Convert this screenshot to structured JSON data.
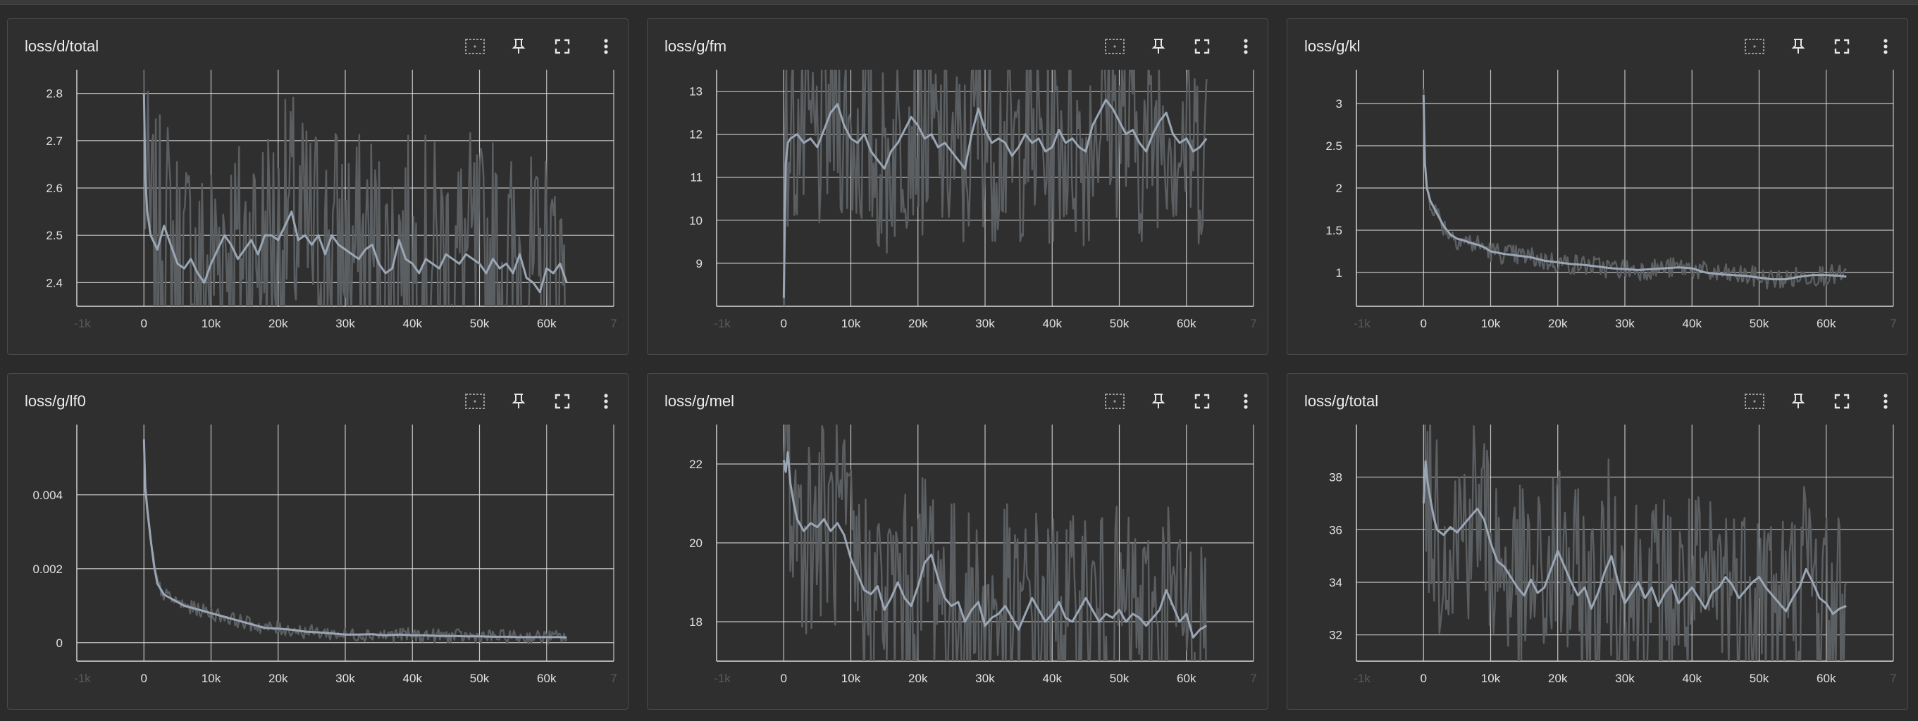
{
  "colors": {
    "raw": "#5c5f62",
    "smoothed": "#9aa6b4",
    "grid": "#dcdcdc",
    "background": "#2f2f2f"
  },
  "toolbar_icons": [
    "fit-domain-icon",
    "pin-icon",
    "fullscreen-icon",
    "more-vert-icon"
  ],
  "chart_data": [
    {
      "id": "loss_d_total",
      "title": "loss/d/total",
      "type": "line",
      "xlim": [
        -10000,
        70000
      ],
      "ylim": [
        2.35,
        2.85
      ],
      "xticks": [
        0,
        10000,
        20000,
        30000,
        40000,
        50000,
        60000
      ],
      "xtick_labels": [
        "0",
        "10k",
        "20k",
        "30k",
        "40k",
        "50k",
        "60k"
      ],
      "xedge_labels": [
        "-1k",
        "7"
      ],
      "yticks": [
        2.4,
        2.5,
        2.6,
        2.7,
        2.8
      ],
      "ytick_labels": [
        "2.4",
        "2.5",
        "2.6",
        "2.7",
        "2.8"
      ],
      "x": [
        0,
        200,
        500,
        1000,
        2000,
        3000,
        4000,
        5000,
        6000,
        7000,
        8000,
        9000,
        10000,
        11000,
        12000,
        13000,
        14000,
        15000,
        16000,
        17000,
        18000,
        19000,
        20000,
        21000,
        22000,
        23000,
        24000,
        25000,
        26000,
        27000,
        28000,
        29000,
        30000,
        31000,
        32000,
        33000,
        34000,
        35000,
        36000,
        37000,
        38000,
        39000,
        40000,
        41000,
        42000,
        43000,
        44000,
        45000,
        46000,
        47000,
        48000,
        49000,
        50000,
        51000,
        52000,
        53000,
        54000,
        55000,
        56000,
        57000,
        58000,
        59000,
        60000,
        61000,
        62000,
        63000
      ],
      "smoothed": [
        2.8,
        2.62,
        2.55,
        2.5,
        2.47,
        2.52,
        2.48,
        2.44,
        2.43,
        2.45,
        2.42,
        2.4,
        2.44,
        2.47,
        2.5,
        2.48,
        2.45,
        2.47,
        2.49,
        2.46,
        2.5,
        2.5,
        2.49,
        2.52,
        2.55,
        2.49,
        2.5,
        2.48,
        2.5,
        2.46,
        2.5,
        2.48,
        2.47,
        2.46,
        2.45,
        2.47,
        2.48,
        2.44,
        2.42,
        2.43,
        2.49,
        2.45,
        2.44,
        2.42,
        2.45,
        2.44,
        2.43,
        2.46,
        2.45,
        2.44,
        2.46,
        2.45,
        2.44,
        2.42,
        2.45,
        2.43,
        2.44,
        2.42,
        2.46,
        2.41,
        2.4,
        2.38,
        2.43,
        2.42,
        2.44,
        2.4
      ],
      "raw_range": [
        2.3,
        2.9
      ]
    },
    {
      "id": "loss_g_fm",
      "title": "loss/g/fm",
      "type": "line",
      "xlim": [
        -10000,
        70000
      ],
      "ylim": [
        8.0,
        13.5
      ],
      "xticks": [
        0,
        10000,
        20000,
        30000,
        40000,
        50000,
        60000
      ],
      "xtick_labels": [
        "0",
        "10k",
        "20k",
        "30k",
        "40k",
        "50k",
        "60k"
      ],
      "xedge_labels": [
        "-1k",
        "7"
      ],
      "yticks": [
        9,
        10,
        11,
        12,
        13
      ],
      "ytick_labels": [
        "9",
        "10",
        "11",
        "12",
        "13"
      ],
      "x": [
        0,
        300,
        600,
        1000,
        2000,
        3000,
        4000,
        5000,
        6000,
        7000,
        8000,
        9000,
        10000,
        11000,
        12000,
        13000,
        14000,
        15000,
        16000,
        17000,
        18000,
        19000,
        20000,
        21000,
        22000,
        23000,
        24000,
        25000,
        26000,
        27000,
        28000,
        29000,
        30000,
        31000,
        32000,
        33000,
        34000,
        35000,
        36000,
        37000,
        38000,
        39000,
        40000,
        41000,
        42000,
        43000,
        44000,
        45000,
        46000,
        47000,
        48000,
        49000,
        50000,
        51000,
        52000,
        53000,
        54000,
        55000,
        56000,
        57000,
        58000,
        59000,
        60000,
        61000,
        62000,
        63000
      ],
      "smoothed": [
        8.2,
        11.3,
        11.8,
        11.9,
        12.0,
        11.8,
        11.9,
        11.7,
        12.1,
        12.5,
        12.7,
        12.2,
        11.9,
        11.8,
        12.0,
        11.6,
        11.4,
        11.2,
        11.6,
        11.8,
        12.1,
        12.4,
        12.2,
        11.9,
        12.0,
        11.7,
        11.8,
        11.6,
        11.4,
        11.2,
        12.0,
        12.6,
        12.1,
        11.8,
        11.9,
        11.8,
        11.5,
        11.7,
        12.0,
        11.8,
        11.9,
        11.6,
        11.7,
        12.1,
        11.8,
        11.9,
        11.7,
        11.6,
        12.2,
        12.5,
        12.8,
        12.6,
        12.3,
        12.0,
        12.1,
        11.8,
        11.6,
        12.0,
        12.3,
        12.5,
        12.0,
        11.8,
        11.9,
        11.6,
        11.7,
        11.9
      ],
      "raw_range": [
        8.5,
        13.8
      ]
    },
    {
      "id": "loss_g_kl",
      "title": "loss/g/kl",
      "type": "line",
      "xlim": [
        -10000,
        70000
      ],
      "ylim": [
        0.6,
        3.4
      ],
      "xticks": [
        0,
        10000,
        20000,
        30000,
        40000,
        50000,
        60000
      ],
      "xtick_labels": [
        "0",
        "10k",
        "20k",
        "30k",
        "40k",
        "50k",
        "60k"
      ],
      "xedge_labels": [
        "-1k",
        "7"
      ],
      "yticks": [
        1,
        1.5,
        2,
        2.5,
        3
      ],
      "ytick_labels": [
        "1",
        "1.5",
        "2",
        "2.5",
        "3"
      ],
      "x": [
        0,
        200,
        500,
        1000,
        2000,
        3000,
        4000,
        5000,
        6000,
        7000,
        8000,
        9000,
        10000,
        12000,
        14000,
        16000,
        18000,
        20000,
        22000,
        24000,
        26000,
        28000,
        30000,
        32000,
        34000,
        36000,
        38000,
        40000,
        42000,
        44000,
        46000,
        48000,
        50000,
        52000,
        54000,
        56000,
        58000,
        60000,
        62000,
        63000
      ],
      "smoothed": [
        3.1,
        2.3,
        2.0,
        1.85,
        1.7,
        1.55,
        1.45,
        1.4,
        1.38,
        1.35,
        1.33,
        1.3,
        1.25,
        1.22,
        1.2,
        1.18,
        1.14,
        1.12,
        1.1,
        1.09,
        1.07,
        1.05,
        1.04,
        1.03,
        1.04,
        1.05,
        1.06,
        1.05,
        1.0,
        0.98,
        0.97,
        0.96,
        0.94,
        0.92,
        0.92,
        0.95,
        0.97,
        0.97,
        0.96,
        0.95
      ],
      "raw_range": [
        0.8,
        1.6
      ]
    },
    {
      "id": "loss_g_lf0",
      "title": "loss/g/lf0",
      "type": "line",
      "xlim": [
        -10000,
        70000
      ],
      "ylim": [
        -0.0005,
        0.0059
      ],
      "xticks": [
        0,
        10000,
        20000,
        30000,
        40000,
        50000,
        60000
      ],
      "xtick_labels": [
        "0",
        "10k",
        "20k",
        "30k",
        "40k",
        "50k",
        "60k"
      ],
      "xedge_labels": [
        "-1k",
        "7"
      ],
      "yticks": [
        0,
        0.002,
        0.004
      ],
      "ytick_labels": [
        "0",
        "0.002",
        "0.004"
      ],
      "x": [
        0,
        200,
        500,
        1000,
        1500,
        2000,
        3000,
        4000,
        5000,
        6000,
        8000,
        10000,
        12000,
        14000,
        16000,
        18000,
        20000,
        22000,
        24000,
        26000,
        28000,
        30000,
        32000,
        34000,
        36000,
        38000,
        40000,
        42000,
        44000,
        46000,
        48000,
        50000,
        52000,
        54000,
        56000,
        58000,
        60000,
        62000,
        63000
      ],
      "smoothed": [
        0.0055,
        0.0042,
        0.0036,
        0.0028,
        0.0021,
        0.0016,
        0.0013,
        0.0012,
        0.0011,
        0.001,
        0.0009,
        0.0008,
        0.0007,
        0.0006,
        0.0005,
        0.0004,
        0.00038,
        0.00035,
        0.0003,
        0.00028,
        0.00025,
        0.00022,
        0.00022,
        0.00023,
        0.0002,
        0.00022,
        0.0002,
        0.0002,
        0.00018,
        0.00018,
        0.00017,
        0.00017,
        0.00016,
        0.00016,
        0.00015,
        0.00015,
        0.00015,
        0.00015,
        0.00014
      ],
      "raw_range": [
        0.0,
        0.0012
      ]
    },
    {
      "id": "loss_g_mel",
      "title": "loss/g/mel",
      "type": "line",
      "xlim": [
        -10000,
        70000
      ],
      "ylim": [
        17.0,
        23.0
      ],
      "xticks": [
        0,
        10000,
        20000,
        30000,
        40000,
        50000,
        60000
      ],
      "xtick_labels": [
        "0",
        "10k",
        "20k",
        "30k",
        "40k",
        "50k",
        "60k"
      ],
      "xedge_labels": [
        "-1k",
        "7"
      ],
      "yticks": [
        18,
        20,
        22
      ],
      "ytick_labels": [
        "18",
        "20",
        "22"
      ],
      "x": [
        0,
        300,
        600,
        1000,
        1500,
        2000,
        3000,
        4000,
        5000,
        6000,
        7000,
        8000,
        9000,
        10000,
        11000,
        12000,
        13000,
        14000,
        15000,
        16000,
        17000,
        18000,
        19000,
        20000,
        21000,
        22000,
        23000,
        24000,
        25000,
        26000,
        27000,
        28000,
        29000,
        30000,
        31000,
        32000,
        33000,
        34000,
        35000,
        36000,
        37000,
        38000,
        39000,
        40000,
        41000,
        42000,
        43000,
        44000,
        45000,
        46000,
        47000,
        48000,
        49000,
        50000,
        51000,
        52000,
        53000,
        54000,
        55000,
        56000,
        57000,
        58000,
        59000,
        60000,
        61000,
        62000,
        63000
      ],
      "smoothed": [
        22.1,
        21.8,
        22.3,
        21.5,
        21.0,
        20.6,
        20.3,
        20.5,
        20.4,
        20.6,
        20.3,
        20.5,
        20.2,
        19.6,
        19.2,
        18.8,
        18.7,
        18.9,
        18.3,
        18.6,
        19.0,
        18.6,
        18.4,
        18.9,
        19.5,
        19.7,
        19.1,
        18.6,
        18.4,
        18.5,
        18.0,
        18.3,
        18.5,
        17.9,
        18.1,
        18.2,
        18.4,
        18.1,
        17.8,
        18.2,
        18.6,
        18.3,
        18.0,
        18.2,
        18.5,
        18.1,
        18.0,
        18.3,
        18.6,
        18.3,
        18.0,
        18.2,
        18.1,
        18.3,
        18.0,
        18.2,
        18.1,
        17.9,
        18.1,
        18.3,
        18.8,
        18.4,
        18.0,
        18.2,
        17.6,
        17.8,
        17.9
      ],
      "raw_range": [
        17.0,
        23.0
      ]
    },
    {
      "id": "loss_g_total",
      "title": "loss/g/total",
      "type": "line",
      "xlim": [
        -10000,
        70000
      ],
      "ylim": [
        31.0,
        40.0
      ],
      "xticks": [
        0,
        10000,
        20000,
        30000,
        40000,
        50000,
        60000
      ],
      "xtick_labels": [
        "0",
        "10k",
        "20k",
        "30k",
        "40k",
        "50k",
        "60k"
      ],
      "xedge_labels": [
        "-1k",
        "7"
      ],
      "yticks": [
        32,
        34,
        36,
        38
      ],
      "ytick_labels": [
        "32",
        "34",
        "36",
        "38"
      ],
      "x": [
        0,
        300,
        600,
        1000,
        1500,
        2000,
        3000,
        4000,
        5000,
        6000,
        7000,
        8000,
        9000,
        10000,
        11000,
        12000,
        13000,
        14000,
        15000,
        16000,
        17000,
        18000,
        19000,
        20000,
        21000,
        22000,
        23000,
        24000,
        25000,
        26000,
        27000,
        28000,
        29000,
        30000,
        31000,
        32000,
        33000,
        34000,
        35000,
        36000,
        37000,
        38000,
        39000,
        40000,
        41000,
        42000,
        43000,
        44000,
        45000,
        46000,
        47000,
        48000,
        49000,
        50000,
        51000,
        52000,
        53000,
        54000,
        55000,
        56000,
        57000,
        58000,
        59000,
        60000,
        61000,
        62000,
        63000
      ],
      "smoothed": [
        37.0,
        38.6,
        37.8,
        37.2,
        36.5,
        36.0,
        35.8,
        36.1,
        35.9,
        36.2,
        36.5,
        36.8,
        36.4,
        35.5,
        34.8,
        34.6,
        34.2,
        33.8,
        33.5,
        34.1,
        33.6,
        33.8,
        34.5,
        35.2,
        34.6,
        34.0,
        33.5,
        33.8,
        33.0,
        33.6,
        34.4,
        35.0,
        34.0,
        33.2,
        33.6,
        34.0,
        33.4,
        33.8,
        33.1,
        33.6,
        33.9,
        33.2,
        33.5,
        33.8,
        33.4,
        33.0,
        33.6,
        33.8,
        34.2,
        33.9,
        33.4,
        33.7,
        34.0,
        34.2,
        33.8,
        33.5,
        33.2,
        32.9,
        33.4,
        33.8,
        34.5,
        34.0,
        33.4,
        33.2,
        32.8,
        33.0,
        33.1
      ],
      "raw_range": [
        31.0,
        40.0
      ]
    }
  ]
}
